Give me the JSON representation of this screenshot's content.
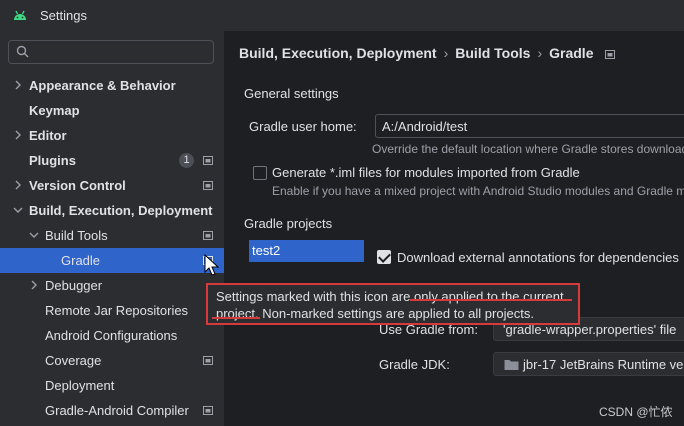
{
  "window": {
    "title": "Settings"
  },
  "search": {
    "placeholder": "",
    "value": ""
  },
  "sidebar": {
    "items": [
      {
        "label": "Appearance & Behavior"
      },
      {
        "label": "Keymap"
      },
      {
        "label": "Editor"
      },
      {
        "label": "Plugins",
        "badge": "1"
      },
      {
        "label": "Version Control"
      },
      {
        "label": "Build, Execution, Deployment"
      },
      {
        "label": "Build Tools"
      },
      {
        "label": "Gradle"
      },
      {
        "label": "Debugger"
      },
      {
        "label": "Remote Jar Repositories"
      },
      {
        "label": "Android Configurations"
      },
      {
        "label": "Coverage"
      },
      {
        "label": "Deployment"
      },
      {
        "label": "Gradle-Android Compiler"
      }
    ]
  },
  "breadcrumb": {
    "items": [
      "Build, Execution, Deployment",
      "Build Tools",
      "Gradle"
    ],
    "separator": "›"
  },
  "general": {
    "title": "General settings",
    "gradle_home_label": "Gradle user home:",
    "gradle_home_value": "A:/Android/test",
    "gradle_home_hint": "Override the default location where Gradle stores download",
    "iml_checkbox_label": "Generate *.iml files for modules imported from Gradle",
    "iml_checkbox_checked": false,
    "iml_hint": "Enable if you have a mixed project with Android Studio modules and Gradle mo"
  },
  "projects": {
    "title": "Gradle projects",
    "items": [
      "test2"
    ],
    "download_annotations_label": "Download external annotations for dependencies",
    "download_annotations_checked": true,
    "use_gradle_from_label": "Use Gradle from:",
    "use_gradle_from_value": "'gradle-wrapper.properties' file",
    "gradle_jdk_label": "Gradle JDK:",
    "gradle_jdk_value": "jbr-17 JetBrains Runtime ve"
  },
  "tooltip": {
    "line1": "Settings marked with this icon are only applied to the current",
    "line2": "project. Non-marked settings are applied to all projects."
  },
  "watermark": "CSDN @忙侬",
  "colors": {
    "background": "#1e1f22",
    "sidebar": "#2b2d30",
    "selection": "#2f65ca",
    "highlight_border": "#d63a3a"
  }
}
